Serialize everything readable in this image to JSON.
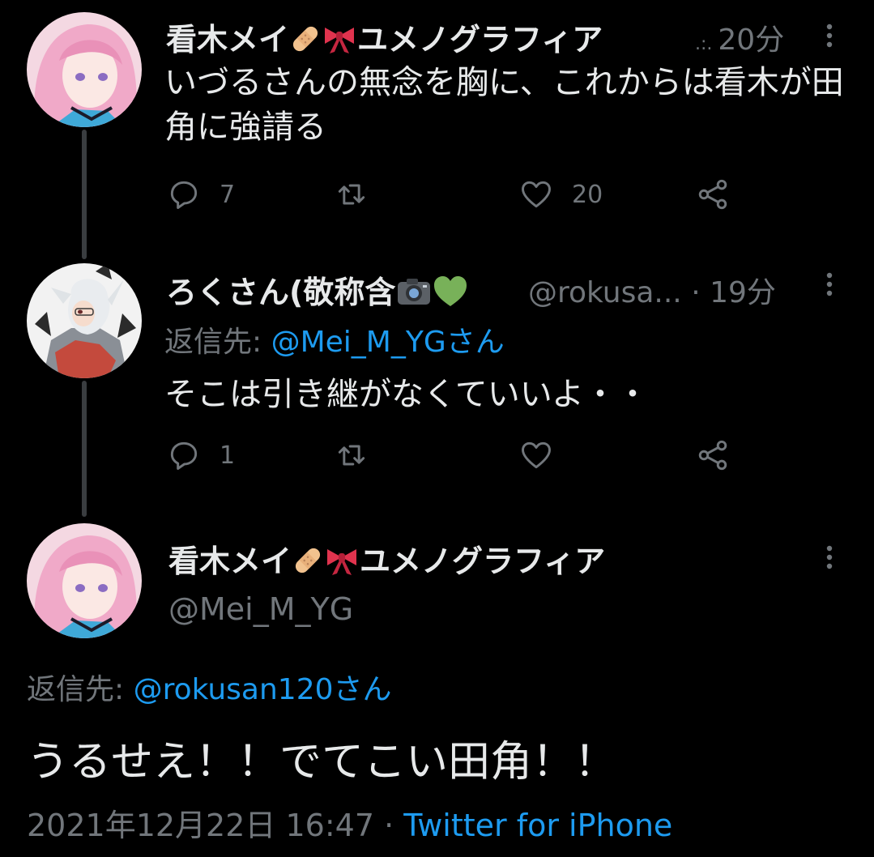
{
  "tweets": [
    {
      "name": "看木メイ",
      "name_suffix": "ユメノグラフィア",
      "ellipsis": " .:. ",
      "time": "20分",
      "text": "いづるさんの無念を胸に、これからは看木が田角に強請る",
      "replies": "7",
      "retweets": "",
      "likes": "20"
    },
    {
      "name": "ろくさん(敬称含",
      "handle": "@rokusa...",
      "sep": " · ",
      "time": "19分",
      "reply_label": "返信先: ",
      "reply_to": "@Mei_M_YGさん",
      "text": "そこは引き継がなくていいよ・・",
      "replies": "1",
      "retweets": "",
      "likes": ""
    }
  ],
  "main_tweet": {
    "name": "看木メイ",
    "name_suffix": "ユメノグラフィア",
    "handle": "@Mei_M_YG",
    "reply_label": "返信先: ",
    "reply_to": "@rokusan120さん",
    "text": "うるせえ！！でてこい田角！！",
    "timestamp": "2021年12月22日 16:47",
    "sep": " · ",
    "source": "Twitter for iPhone"
  },
  "colors": {
    "background": "#000000",
    "text": "#e7e9ea",
    "muted": "#71767b",
    "link": "#1d9bf0",
    "thread_line": "#3a3d40"
  },
  "icons": [
    "reply-icon",
    "retweet-icon",
    "like-icon",
    "share-icon",
    "more-icon",
    "bandage-emoji",
    "ribbon-emoji",
    "camera-emoji",
    "green-heart-emoji"
  ]
}
